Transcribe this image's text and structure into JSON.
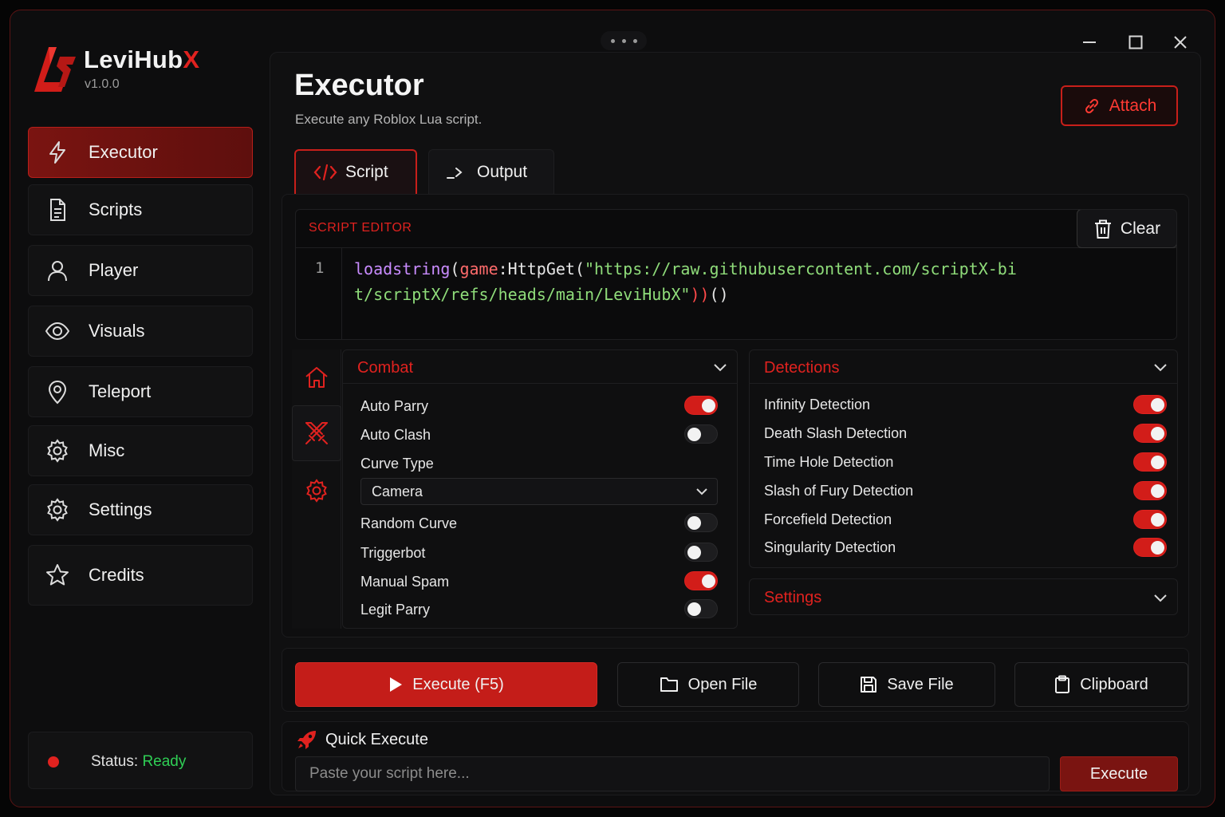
{
  "app": {
    "name": "LeviHub",
    "name_accent": "X",
    "version": "v1.0.0"
  },
  "window": {
    "minimize": "minimize",
    "maximize": "maximize",
    "close": "close"
  },
  "sidebar": {
    "items": [
      {
        "label": "Executor",
        "icon": "lightning-icon",
        "active": true
      },
      {
        "label": "Scripts",
        "icon": "document-icon"
      },
      {
        "label": "Player",
        "icon": "user-icon"
      },
      {
        "label": "Visuals",
        "icon": "eye-icon"
      },
      {
        "label": "Teleport",
        "icon": "map-pin-icon"
      },
      {
        "label": "Misc",
        "icon": "gear-icon"
      },
      {
        "label": "Settings",
        "icon": "gear-icon"
      },
      {
        "label": "Credits",
        "icon": "star-icon"
      }
    ],
    "status": {
      "label": "Status:",
      "value": "Ready"
    }
  },
  "header": {
    "title": "Executor",
    "subtitle": "Execute any Roblox Lua script.",
    "attach_label": "Attach"
  },
  "tabs": [
    {
      "label": "Script",
      "icon": "code-icon",
      "active": true
    },
    {
      "label": "Output",
      "icon": "terminal-icon"
    }
  ],
  "editor": {
    "label": "SCRIPT EDITOR",
    "clear_label": "Clear",
    "line_number": "1",
    "code": {
      "fn": "loadstring",
      "p1": "(",
      "obj": "game",
      "method": ":HttpGet(",
      "str": "\"https://raw.githubusercontent.com/scriptX-bit/scriptX/refs/heads/main/LeviHubX\"",
      "p2": "))",
      "tail": "()"
    }
  },
  "mini_nav": [
    "home-icon",
    "crossed-swords-icon",
    "gear-icon"
  ],
  "combat": {
    "title": "Combat",
    "rows": [
      {
        "label": "Auto Parry",
        "on": true
      },
      {
        "label": "Auto Clash",
        "on": false
      }
    ],
    "curve_label": "Curve Type",
    "curve_value": "Camera",
    "rows2": [
      {
        "label": "Random Curve",
        "on": false
      },
      {
        "label": "Triggerbot",
        "on": false
      },
      {
        "label": "Manual Spam",
        "on": true
      },
      {
        "label": "Legit Parry",
        "on": false
      }
    ]
  },
  "detections": {
    "title": "Detections",
    "rows": [
      {
        "label": "Infinity Detection",
        "on": true
      },
      {
        "label": "Death Slash Detection",
        "on": true
      },
      {
        "label": "Time Hole Detection",
        "on": true
      },
      {
        "label": "Slash of Fury Detection",
        "on": true
      },
      {
        "label": "Forcefield Detection",
        "on": true
      },
      {
        "label": "Singularity Detection",
        "on": true
      }
    ]
  },
  "settings_panel": {
    "title": "Settings"
  },
  "actions": {
    "execute": "Execute (F5)",
    "open": "Open File",
    "save": "Save File",
    "clipboard": "Clipboard"
  },
  "quick": {
    "label": "Quick Execute",
    "placeholder": "Paste your script here...",
    "button": "Execute"
  },
  "colors": {
    "accent": "#e0221f",
    "status_ok": "#2fcf55",
    "bg": "#0d0d0e"
  }
}
